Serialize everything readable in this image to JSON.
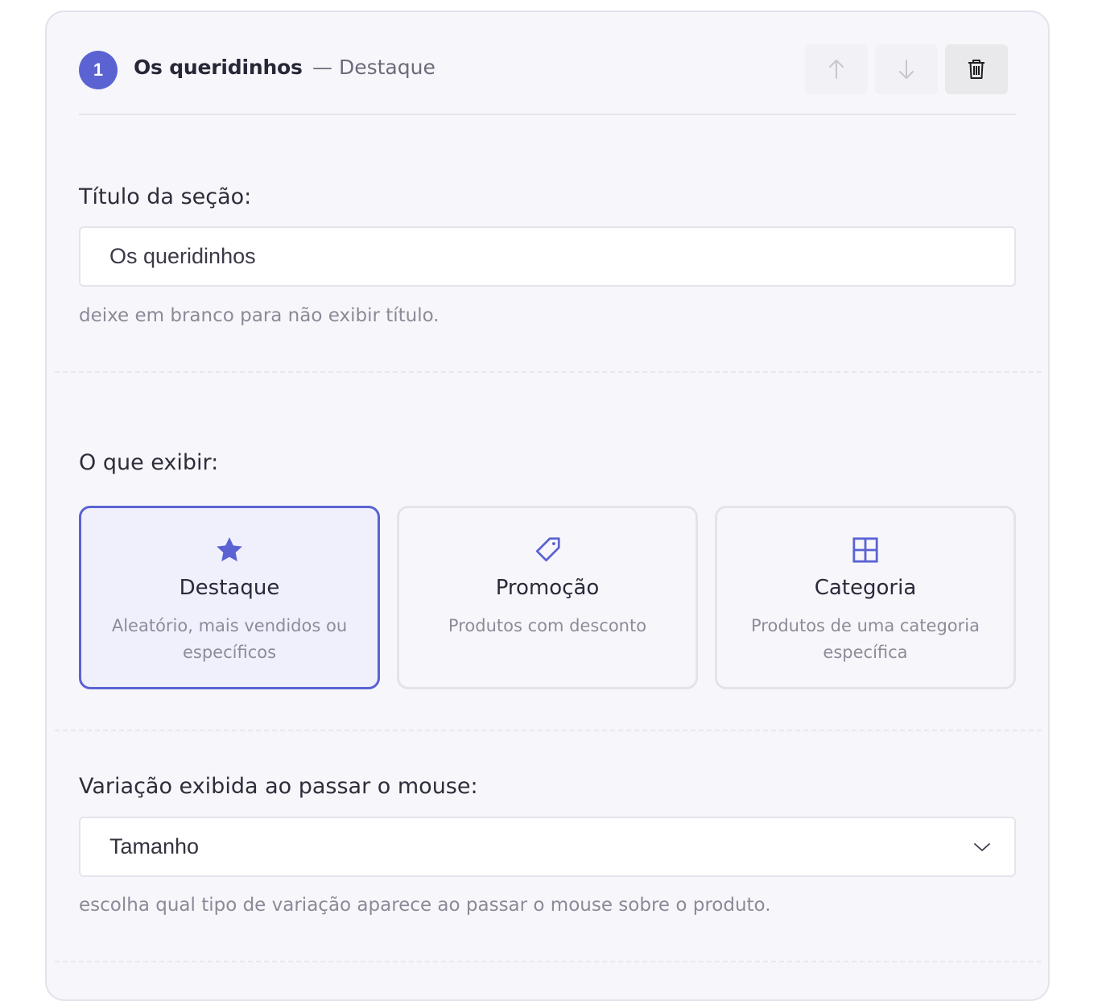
{
  "section": {
    "step_number": "1",
    "title": "Os queridinhos",
    "type_label": "— Destaque",
    "actions": {
      "move_up_icon": "arrow-up-icon",
      "move_down_icon": "arrow-down-icon",
      "delete_icon": "trash-icon"
    }
  },
  "title_field": {
    "label": "Título da seção:",
    "value": "Os queridinhos",
    "help": "deixe em branco para não exibir título."
  },
  "display": {
    "label": "O que exibir:",
    "options": [
      {
        "icon": "star-icon",
        "title": "Destaque",
        "description": "Aleatório, mais vendidos ou específicos",
        "selected": true
      },
      {
        "icon": "tag-icon",
        "title": "Promoção",
        "description": "Produtos com desconto",
        "selected": false
      },
      {
        "icon": "grid-icon",
        "title": "Categoria",
        "description": "Produtos de uma categoria específica",
        "selected": false
      }
    ]
  },
  "variation": {
    "label": "Variação exibida ao passar o mouse:",
    "selected": "Tamanho",
    "help": "escolha qual tipo de variação aparece ao passar o mouse sobre o produto."
  },
  "colors": {
    "accent": "#5b63d3",
    "card_bg": "#f7f7fb",
    "selected_bg": "#f0f0fc"
  }
}
